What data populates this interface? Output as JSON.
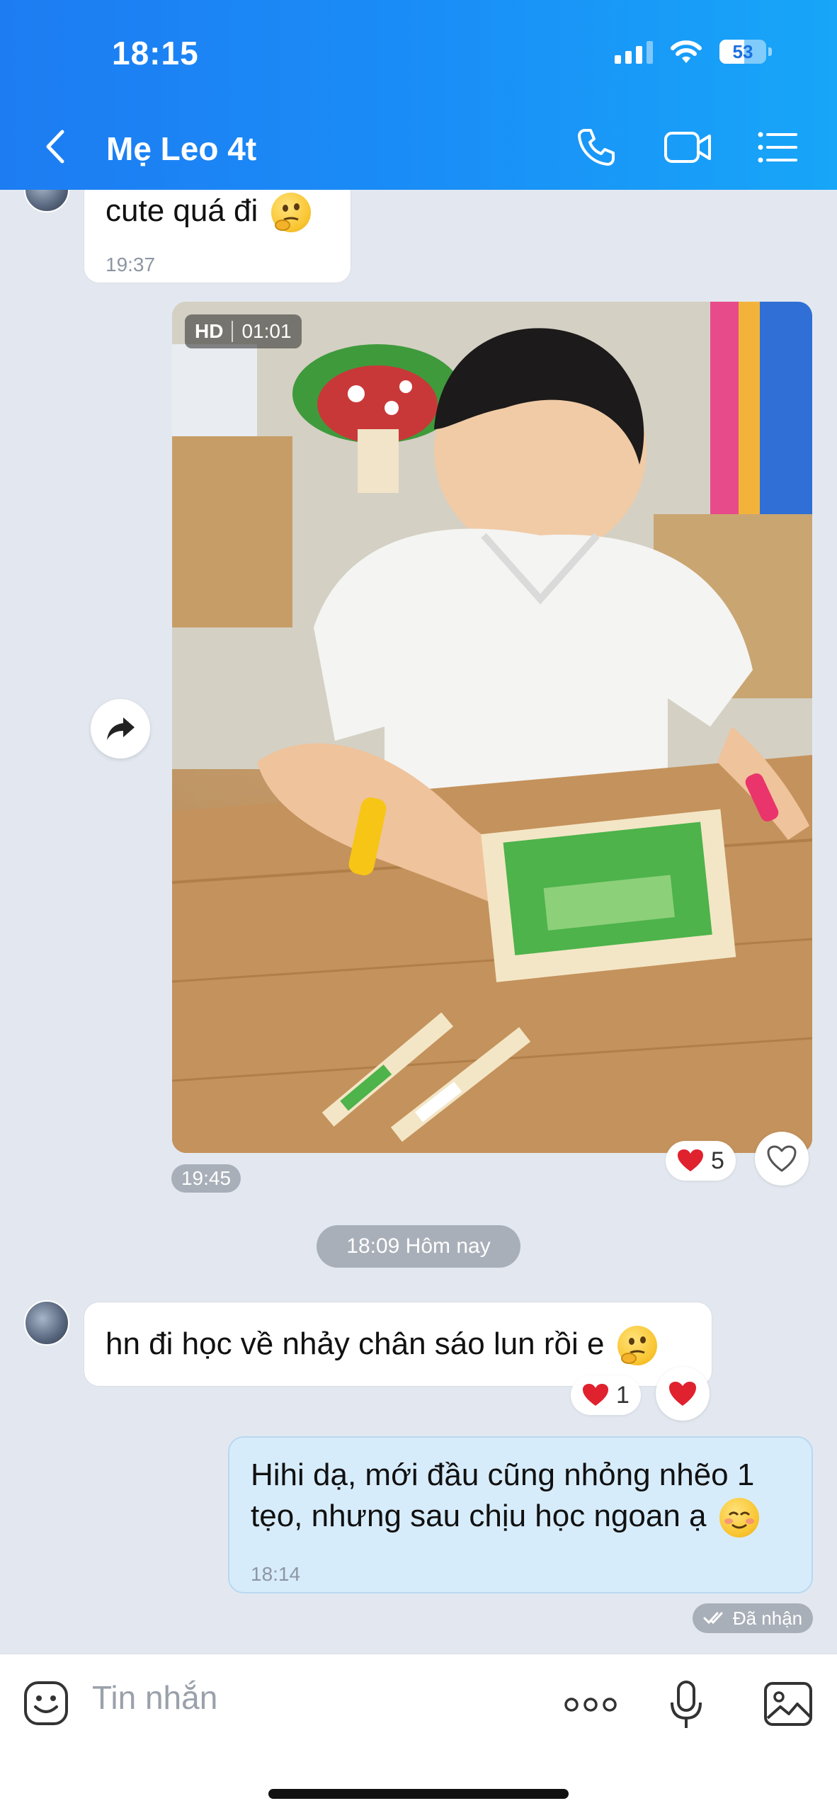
{
  "status_bar": {
    "time": "18:15",
    "battery": "53",
    "battery_level_percent": 53
  },
  "header": {
    "title": "Mẹ Leo 4t",
    "icons": [
      "back-arrow-icon",
      "phone-icon",
      "video-call-icon",
      "menu-list-icon"
    ]
  },
  "messages": [
    {
      "type": "incoming",
      "text": "cute quá đi",
      "time": "19:37",
      "emoji": "thinking-face"
    },
    {
      "type": "outgoing-video",
      "quality": "HD",
      "duration": "01:01",
      "time": "19:45",
      "reaction_count": "5"
    },
    {
      "type": "date-divider",
      "text": "18:09 Hôm nay"
    },
    {
      "type": "incoming",
      "text": "hn đi học về nhảy chân sáo lun rồi e",
      "emoji": "thinking-face",
      "reaction_count": "1"
    },
    {
      "type": "outgoing",
      "line1": "Hihi dạ, mới đầu cũng nhỏng nhẽo 1",
      "line2": "tẹo, nhưng sau chịu học ngoan ạ",
      "emoji": "smiling-face",
      "time": "18:14",
      "status": "Đã nhận"
    }
  ],
  "composer": {
    "placeholder": "Tin nhắn",
    "icons": [
      "sticker-icon",
      "more-dots-icon",
      "microphone-icon",
      "image-icon"
    ]
  },
  "colors": {
    "header_start": "#1d7cf2",
    "header_end": "#17a6f8",
    "chat_bg": "#e3e8f0",
    "outgoing_bubble": "#d7ecfb",
    "heart": "#e0212e"
  }
}
